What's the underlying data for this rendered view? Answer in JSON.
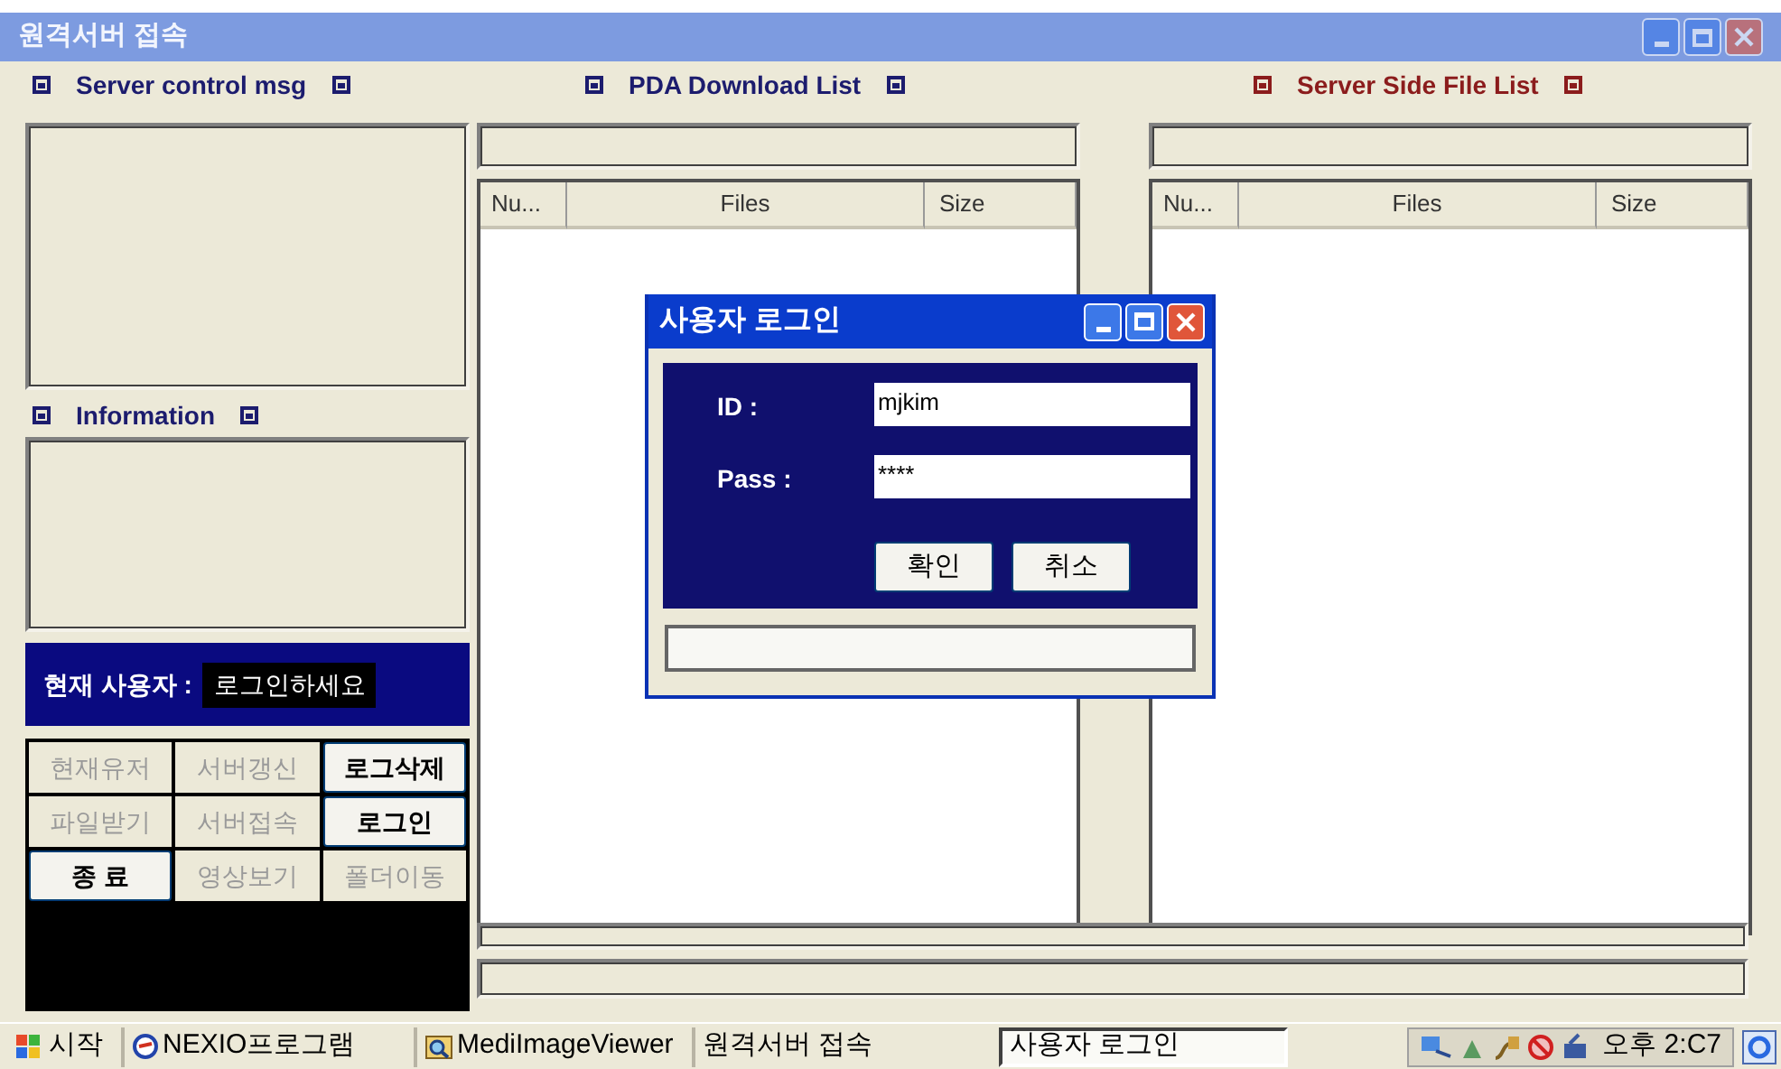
{
  "window": {
    "title": "원격서버 접속",
    "active": false
  },
  "headings": [
    {
      "label": "Server control msg",
      "color": "#1c1c6e"
    },
    {
      "label": "PDA Download List",
      "color": "#1c1c6e"
    },
    {
      "label": "Server Side File List",
      "color": "#8b1c1c"
    },
    {
      "label": "Information",
      "color": "#1c1c6e"
    }
  ],
  "current_user": {
    "label": "현재 사용자 :",
    "value": "로그인하세요"
  },
  "buttons": [
    {
      "label": "현재유저",
      "disabled": true
    },
    {
      "label": "서버갱신",
      "disabled": true
    },
    {
      "label": "로그삭제",
      "disabled": false
    },
    {
      "label": "파일받기",
      "disabled": true
    },
    {
      "label": "서버접속",
      "disabled": true
    },
    {
      "label": "로그인",
      "disabled": false
    },
    {
      "label": "종 료",
      "disabled": false
    },
    {
      "label": "영상보기",
      "disabled": true
    },
    {
      "label": "폴더이동",
      "disabled": true
    }
  ],
  "pda_list": {
    "columns": [
      "Nu...",
      "Files",
      "Size"
    ]
  },
  "server_list": {
    "columns": [
      "Nu...",
      "Files",
      "Size"
    ]
  },
  "dialog": {
    "title": "사용자 로그인",
    "id_label": "ID :",
    "id_value": "mjkim",
    "pass_label": "Pass :",
    "pass_value": "****",
    "buttons": [
      "확인",
      "취소"
    ]
  },
  "taskbar": {
    "start": "시작",
    "tasks": [
      {
        "label": "NEXIO프로그램",
        "selected": false
      },
      {
        "label": "MediImageViewer",
        "selected": false
      },
      {
        "label": "원격서버 접속",
        "selected": false
      },
      {
        "label": "사용자 로그인",
        "selected": true
      }
    ],
    "clock": "오후 2:C7"
  }
}
